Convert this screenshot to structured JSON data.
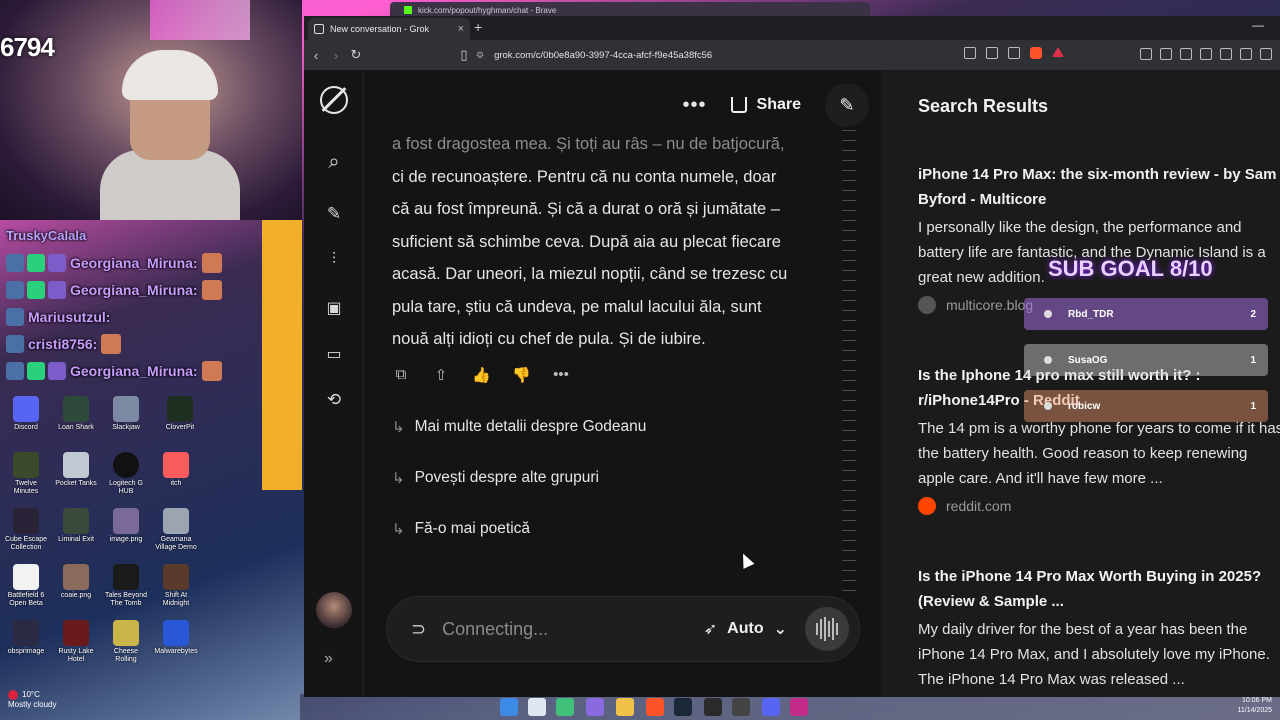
{
  "stream": {
    "cam_count": "6794",
    "chat": [
      {
        "user": "Georgiana_Miruna:"
      },
      {
        "user": "Georgiana_Miruna:"
      },
      {
        "user": "Mariusutzul:"
      },
      {
        "user": "cristi8756:"
      },
      {
        "user": "Georgiana_Miruna:"
      }
    ],
    "top_user": "TruskyCalala"
  },
  "desktop_icons": [
    {
      "label": "Discord",
      "icon": "discord-icon"
    },
    {
      "label": "Loan Shark",
      "icon": "game-icon"
    },
    {
      "label": "Slackjaw",
      "icon": "game-icon"
    },
    {
      "label": "CloverPit",
      "icon": "game-icon"
    },
    {
      "label": "Twelve Minutes",
      "icon": "game-icon"
    },
    {
      "label": "Pocket Tanks",
      "icon": "game-icon"
    },
    {
      "label": "Logitech G HUB",
      "icon": "logitech-icon"
    },
    {
      "label": "itch",
      "icon": "itch-icon"
    },
    {
      "label": "Cube Escape Collection",
      "icon": "game-icon"
    },
    {
      "label": "Liminal Exit",
      "icon": "game-icon"
    },
    {
      "label": "image.png",
      "icon": "image-icon"
    },
    {
      "label": "Geamana Village Demo",
      "icon": "game-icon"
    },
    {
      "label": "Battlefield 6 Open Beta",
      "icon": "file-icon"
    },
    {
      "label": "coaie.png",
      "icon": "image-icon"
    },
    {
      "label": "Tales Beyond The Tomb",
      "icon": "game-icon"
    },
    {
      "label": "Shift At Midnight",
      "icon": "game-icon"
    },
    {
      "label": "obsprimage",
      "icon": "game-icon"
    },
    {
      "label": "Rusty Lake Hotel",
      "icon": "game-icon"
    },
    {
      "label": "Cheese Rolling",
      "icon": "game-icon"
    },
    {
      "label": "Malwarebytes",
      "icon": "malwarebytes-icon"
    }
  ],
  "weather": {
    "temp": "10°C",
    "desc": "Mostly cloudy"
  },
  "clock": {
    "time": "10:06 PM",
    "date": "11/14/2025"
  },
  "browser": {
    "background_tab_title": "kick.com/popout/hyghman/chat - Brave",
    "tab_title": "New conversation - Grok",
    "url": "grok.com/c/0b0e8a90-3997-4cca-afcf-f9e45a38fc56"
  },
  "grok": {
    "header": {
      "share_label": "Share"
    },
    "message": {
      "line_faded": "a fost dragostea mea. Și toți au râs – nu de batjocură,",
      "lines": [
        "ci de recunoaștere. Pentru că nu conta numele, doar",
        "că au fost împreună. Și că a durat o oră și jumătate –",
        "suficient să schimbe ceva. După aia au plecat fiecare",
        "acasă. Dar uneori, la miezul nopții, când se trezesc cu",
        "pula tare, știu că undeva, pe malul lacului ăla, sunt",
        "nouă alți idioți cu chef de pula. Și de iubire."
      ]
    },
    "followups": [
      "Mai multe detalii despre Godeanu",
      "Povești despre alte grupuri",
      "Fă-o mai poetică"
    ],
    "input": {
      "placeholder": "Connecting...",
      "mode": "Auto"
    }
  },
  "search_results": {
    "title": "Search Results",
    "items": [
      {
        "title": "iPhone 14 Pro Max: the six-month review - by Sam Byford - Multicore",
        "snippet": "I personally like the design, the performance and battery life are fantastic, and the Dynamic Island is a great new addition.",
        "source": "multicore.blog"
      },
      {
        "title": "Is the Iphone 14 pro max still worth it? : r/iPhone14Pro - Reddit",
        "snippet": "The 14 pm is a worthy phone for years to come if it has the battery health. Good reason to keep renewing apple care. And it'll have few more ...",
        "source": "reddit.com"
      },
      {
        "title": "Is the iPhone 14 Pro Max Worth Buying in 2025? (Review & Sample ...",
        "snippet": "My daily driver for the best of a year has been the iPhone 14 Pro Max, and I absolutely love my iPhone. The iPhone 14 Pro Max was released ...",
        "source": ""
      }
    ]
  },
  "sub_goal": {
    "title": "SUB GOAL 8/10",
    "rows": [
      {
        "name": "Rbd_TDR",
        "count": "2",
        "color": "#c9a2ff"
      },
      {
        "name": "SusaOG",
        "count": "1",
        "color": "#e9e9e9"
      },
      {
        "name": "robicw",
        "count": "1",
        "color": "#ffb088"
      }
    ]
  }
}
